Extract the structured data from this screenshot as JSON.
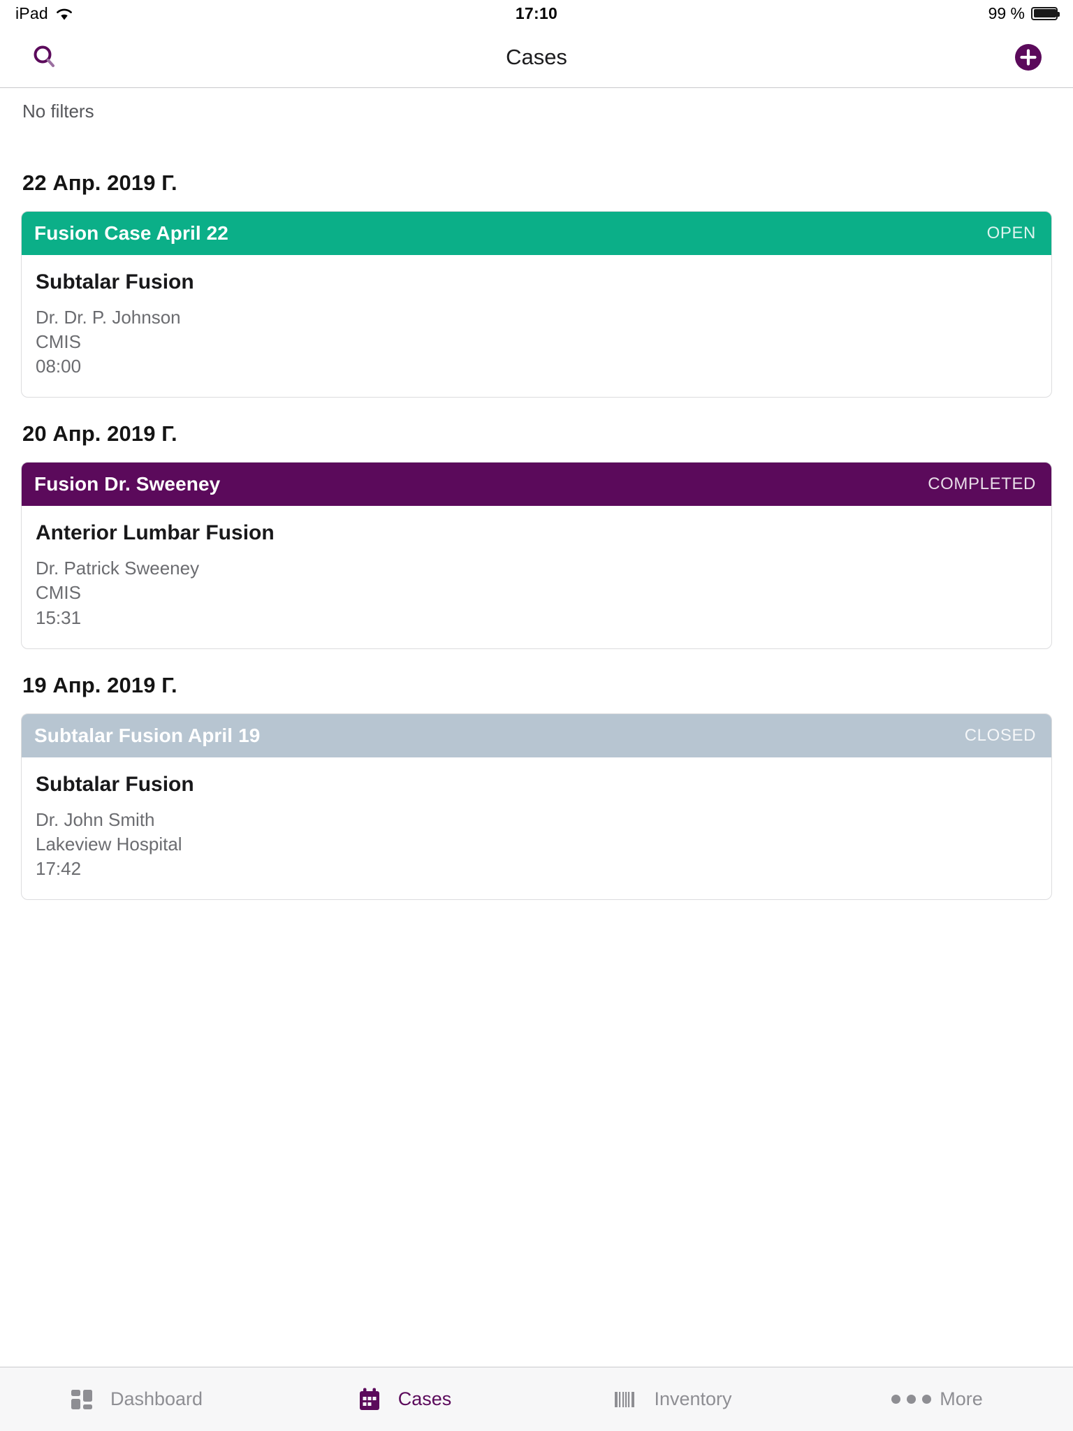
{
  "statusbar": {
    "device": "iPad",
    "wifi_icon": "wifi-icon",
    "time": "17:10",
    "battery_percent": "99 %",
    "battery_icon": "battery-icon"
  },
  "navbar": {
    "search_icon": "search-icon",
    "title": "Cases",
    "add_icon": "plus-circle-icon",
    "accent_color": "#5B0A5B"
  },
  "filter_bar": {
    "label": "No filters"
  },
  "groups": [
    {
      "date": "22 Апр. 2019 Г.",
      "cases": [
        {
          "title": "Fusion Case April 22",
          "status": "OPEN",
          "status_color": "#0BAF88",
          "procedure": "Subtalar Fusion",
          "surgeon": "Dr. Dr. P. Johnson",
          "facility": "CMIS",
          "time": "08:00"
        }
      ]
    },
    {
      "date": "20 Апр. 2019 Г.",
      "cases": [
        {
          "title": "Fusion Dr. Sweeney",
          "status": "COMPLETED",
          "status_color": "#5B0A5B",
          "procedure": "Anterior Lumbar Fusion",
          "surgeon": "Dr. Patrick Sweeney",
          "facility": "CMIS",
          "time": "15:31"
        }
      ]
    },
    {
      "date": "19 Апр. 2019 Г.",
      "cases": [
        {
          "title": "Subtalar Fusion April 19",
          "status": "CLOSED",
          "status_color": "#B7C5D1",
          "procedure": "Subtalar Fusion",
          "surgeon": "Dr. John Smith",
          "facility": "Lakeview Hospital",
          "time": "17:42"
        }
      ]
    }
  ],
  "tabbar": {
    "items": [
      {
        "label": "Dashboard",
        "icon": "dashboard-grid-icon",
        "active": false
      },
      {
        "label": "Cases",
        "icon": "calendar-icon",
        "active": true
      },
      {
        "label": "Inventory",
        "icon": "barcode-icon",
        "active": false
      },
      {
        "label": "More",
        "icon": "ellipsis-icon",
        "active": false
      }
    ],
    "active_color": "#5B0A5B",
    "inactive_color": "#8E8E93"
  }
}
